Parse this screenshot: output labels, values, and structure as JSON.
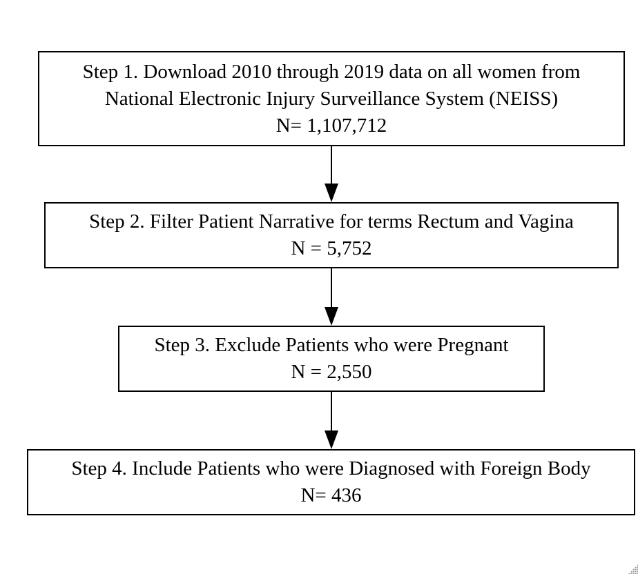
{
  "flowchart": {
    "steps": [
      {
        "lines": [
          "Step 1. Download 2010 through 2019 data on all women from",
          "National Electronic Injury Surveillance System (NEISS)",
          "N= 1,107,712"
        ]
      },
      {
        "lines": [
          "Step 2. Filter Patient Narrative for terms Rectum and Vagina",
          "N = 5,752"
        ]
      },
      {
        "lines": [
          "Step 3. Exclude Patients who were Pregnant",
          "N = 2,550"
        ]
      },
      {
        "lines": [
          "Step 4. Include Patients who were Diagnosed with Foreign Body",
          "N= 436"
        ]
      }
    ]
  }
}
